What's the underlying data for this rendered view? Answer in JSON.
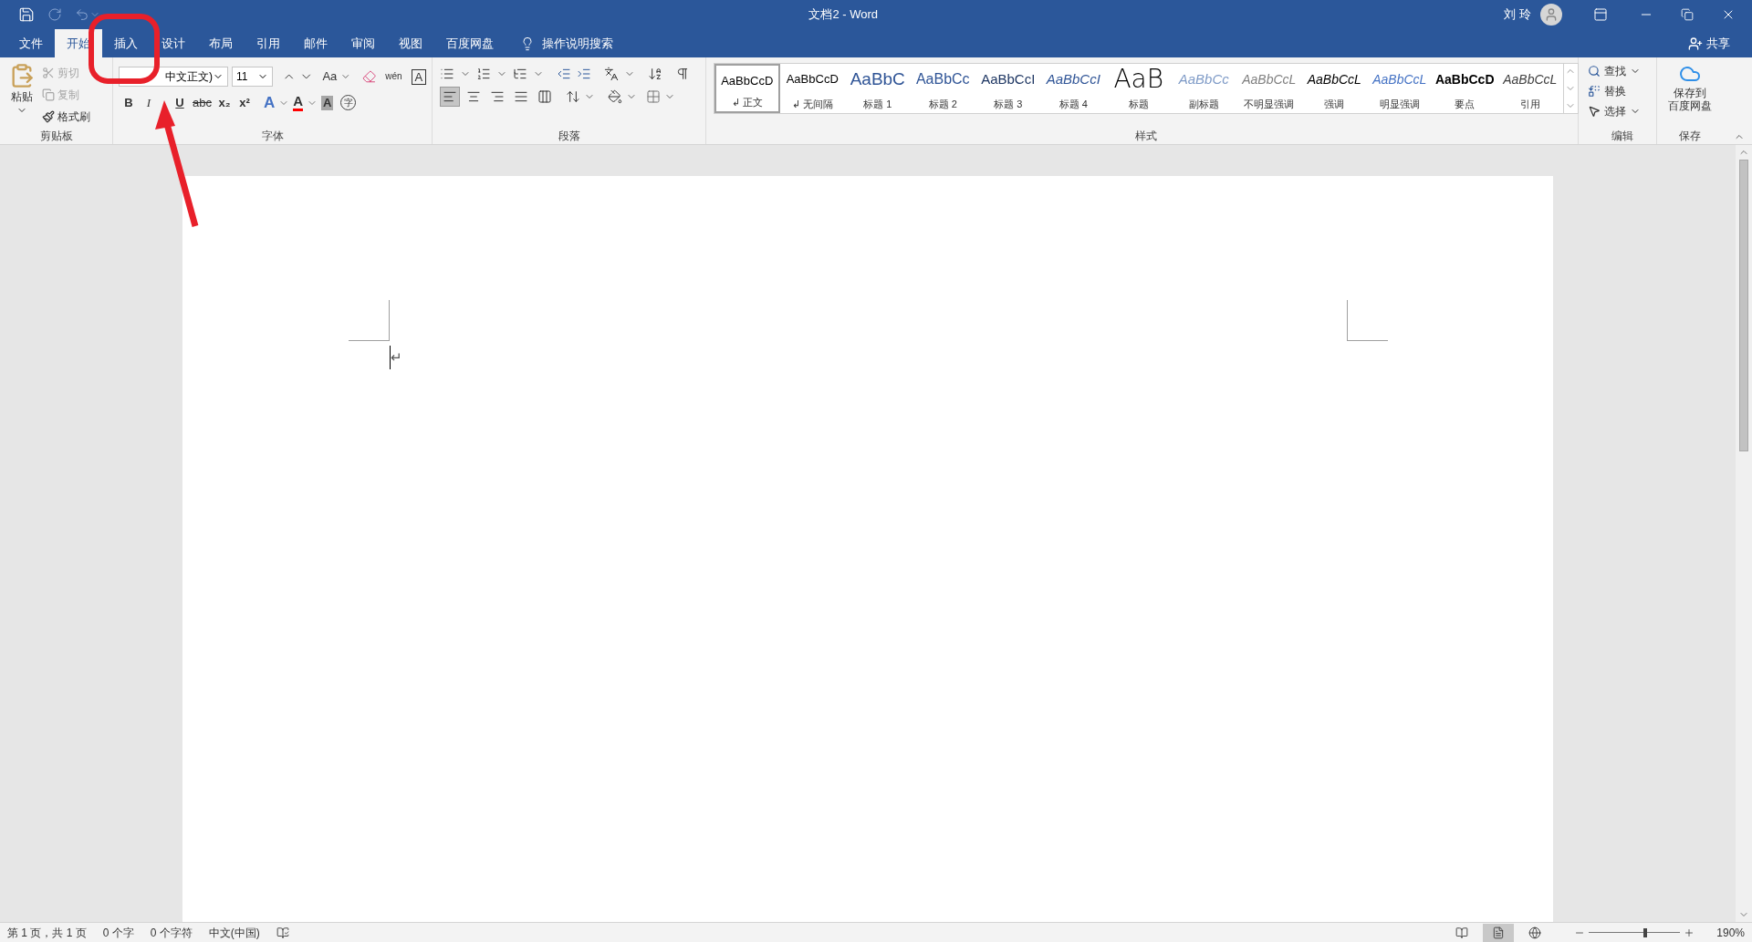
{
  "window": {
    "title": "文档2 - Word",
    "user": "刘 玲"
  },
  "tabs": [
    {
      "label": "文件",
      "selected": false
    },
    {
      "label": "开始",
      "selected": true
    },
    {
      "label": "插入",
      "selected": false
    },
    {
      "label": "设计",
      "selected": false
    },
    {
      "label": "布局",
      "selected": false
    },
    {
      "label": "引用",
      "selected": false
    },
    {
      "label": "邮件",
      "selected": false
    },
    {
      "label": "审阅",
      "selected": false
    },
    {
      "label": "视图",
      "selected": false
    },
    {
      "label": "百度网盘",
      "selected": false
    }
  ],
  "tell_me": "操作说明搜索",
  "share": "共享",
  "clipboard": {
    "label": "剪贴板",
    "paste": "粘贴",
    "cut": {
      "label": "剪切",
      "disabled": true
    },
    "copy": {
      "label": "复制",
      "disabled": true
    },
    "format_painter": {
      "label": "格式刷",
      "disabled": false
    }
  },
  "font": {
    "label": "字体",
    "font_name": "中文正文)",
    "font_size": "11",
    "case_button": "Aa",
    "phonetic": "wén",
    "border_char": "A",
    "format_buttons": [
      {
        "glyph": "B",
        "kind": "bold"
      },
      {
        "glyph": "I",
        "kind": "italic"
      },
      {
        "glyph": "U",
        "kind": "underline"
      },
      {
        "glyph": "abc",
        "kind": "strike"
      },
      {
        "glyph": "x₂",
        "kind": "plain"
      },
      {
        "glyph": "x²",
        "kind": "plain"
      }
    ],
    "color_buttons": [
      {
        "glyph": "A",
        "kind": "effect"
      },
      {
        "glyph": "A",
        "kind": "color"
      },
      {
        "glyph": "A",
        "kind": "shade"
      },
      {
        "glyph": "字",
        "kind": "enclose"
      }
    ]
  },
  "paragraph": {
    "label": "段落",
    "alignments": [
      {
        "selected": true
      },
      {
        "selected": false
      },
      {
        "selected": false
      },
      {
        "selected": false
      },
      {
        "selected": false
      }
    ]
  },
  "styles": {
    "label": "样式",
    "items": [
      {
        "preview": "AaBbCcD",
        "name": "↲ 正文",
        "selected": true
      },
      {
        "preview": "AaBbCcD",
        "name": "↲ 无间隔",
        "selected": false
      },
      {
        "preview": "AaBbC",
        "name": "标题 1",
        "selected": false
      },
      {
        "preview": "AaBbCc",
        "name": "标题 2",
        "selected": false
      },
      {
        "preview": "AaBbCcI",
        "name": "标题 3",
        "selected": false
      },
      {
        "preview": "AaBbCcI",
        "name": "标题 4",
        "selected": false
      },
      {
        "preview": "AaB",
        "name": "标题",
        "selected": false
      },
      {
        "preview": "AaBbCc",
        "name": "副标题",
        "selected": false
      },
      {
        "preview": "AaBbCcL",
        "name": "不明显强调",
        "selected": false
      },
      {
        "preview": "AaBbCcL",
        "name": "强调",
        "selected": false
      },
      {
        "preview": "AaBbCcL",
        "name": "明显强调",
        "selected": false
      },
      {
        "preview": "AaBbCcD",
        "name": "要点",
        "selected": false
      },
      {
        "preview": "AaBbCcL",
        "name": "引用",
        "selected": false
      }
    ]
  },
  "editing": {
    "label": "编辑",
    "find": "查找",
    "replace": "替换",
    "select": "选择"
  },
  "save": {
    "label": "保存",
    "button": [
      "保存到",
      "百度网盘"
    ]
  },
  "document": {
    "paragraph_mark": "↵"
  },
  "status_bar": {
    "page": "第 1 页，共 1 页",
    "words": "0 个字",
    "chars": "0 个字符",
    "language": "中文(中国)",
    "views": [
      {
        "selected": false
      },
      {
        "selected": true
      },
      {
        "selected": false
      }
    ],
    "zoom": {
      "level": 0.6
    },
    "zoom_text": "190%"
  }
}
